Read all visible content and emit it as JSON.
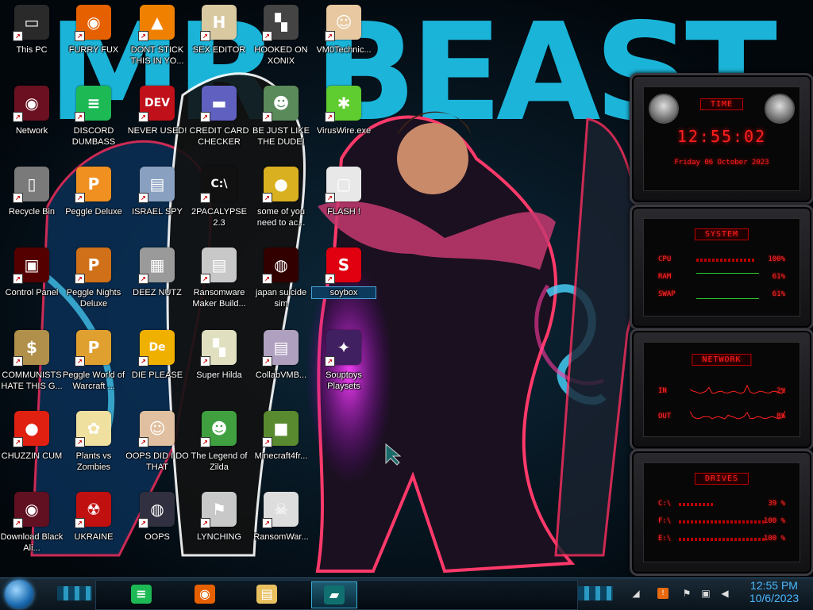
{
  "wallpaper": {
    "title_text": "MR BEAST"
  },
  "desktop_icons": [
    {
      "label": "This PC",
      "icon": "computer-icon",
      "color": "#2a2a2a",
      "glyph": "▭",
      "col": 0,
      "row": 0
    },
    {
      "label": "FURRY FUX",
      "icon": "firefox-icon",
      "color": "#e66000",
      "glyph": "◉",
      "col": 1,
      "row": 0
    },
    {
      "label": "DONT STICK THIS IN YO...",
      "icon": "vlc-cone-icon",
      "color": "#f08000",
      "glyph": "▲",
      "col": 2,
      "row": 0
    },
    {
      "label": "SEX EDITOR",
      "icon": "hxd-icon",
      "color": "#d9c9a0",
      "glyph": "H",
      "col": 3,
      "row": 0
    },
    {
      "label": "HOOKED ON XONIX",
      "icon": "xonix-game-icon",
      "color": "#444",
      "glyph": "▚",
      "col": 4,
      "row": 0
    },
    {
      "label": "VM0Technic...",
      "icon": "doctor-icon",
      "color": "#e8c8a0",
      "glyph": "☺",
      "col": 5,
      "row": 0
    },
    {
      "label": "Network",
      "icon": "alienware-network-icon",
      "color": "#6a1020",
      "glyph": "◉",
      "col": 0,
      "row": 1
    },
    {
      "label": "DISCORD DUMBASS",
      "icon": "spotify-green-icon",
      "color": "#1db954",
      "glyph": "≡",
      "col": 1,
      "row": 1
    },
    {
      "label": "NEVER USED!",
      "icon": "devcpp-icon",
      "color": "#c0101a",
      "glyph": "DEV",
      "col": 2,
      "row": 1
    },
    {
      "label": "CREDIT CARD CHECKER",
      "icon": "credit-card-icon",
      "color": "#6060c0",
      "glyph": "▬",
      "col": 3,
      "row": 1
    },
    {
      "label": "BE JUST LIKE THE DUDE!",
      "icon": "santa-icon",
      "color": "#5a8a5a",
      "glyph": "☻",
      "col": 4,
      "row": 1
    },
    {
      "label": "VirusWire.exe",
      "icon": "limewire-icon",
      "color": "#5fcc2f",
      "glyph": "✱",
      "col": 5,
      "row": 1
    },
    {
      "label": "Recycle Bin",
      "icon": "recycle-bin-icon",
      "color": "#7a7a7a",
      "glyph": "▯",
      "col": 0,
      "row": 2
    },
    {
      "label": "Peggle Deluxe",
      "icon": "peggle-icon",
      "color": "#f09020",
      "glyph": "P",
      "col": 1,
      "row": 2
    },
    {
      "label": "ISRAEL SPY",
      "icon": "network-spy-icon",
      "color": "#8aa0c0",
      "glyph": "▤",
      "col": 2,
      "row": 2
    },
    {
      "label": "2PACALYPSE 2.3",
      "icon": "terminal-icon",
      "color": "#111",
      "glyph": "C:\\",
      "col": 3,
      "row": 2
    },
    {
      "label": "some of you need to ac...",
      "icon": "beaver-icon",
      "color": "#d9b020",
      "glyph": "●",
      "col": 4,
      "row": 2
    },
    {
      "label": "FLASH !",
      "icon": "document-icon",
      "color": "#e8e8e8",
      "glyph": "▢",
      "col": 5,
      "row": 2
    },
    {
      "label": "Control Panel",
      "icon": "alienware-control-icon",
      "color": "#500",
      "glyph": "▣",
      "col": 0,
      "row": 3
    },
    {
      "label": "Peggle Nights Deluxe",
      "icon": "peggle-nights-icon",
      "color": "#d07018",
      "glyph": "P",
      "col": 1,
      "row": 3
    },
    {
      "label": "DEEZ NUTZ",
      "icon": "stacked-windows-icon",
      "color": "#9a9a9a",
      "glyph": "▦",
      "col": 2,
      "row": 3
    },
    {
      "label": "Ransomware Maker Build...",
      "icon": "app-window-icon",
      "color": "#c8c8c8",
      "glyph": "▤",
      "col": 3,
      "row": 3
    },
    {
      "label": "japan suicide sim",
      "icon": "alien-window-icon",
      "color": "#300",
      "glyph": "◍",
      "col": 4,
      "row": 3
    },
    {
      "label": "soybox",
      "icon": "soybox-icon",
      "color": "#e00010",
      "glyph": "S",
      "col": 5,
      "row": 3,
      "selected": true
    },
    {
      "label": "COMMUNISTS HATE THIS G...",
      "icon": "money-bag-icon",
      "color": "#b0904a",
      "glyph": "$",
      "col": 0,
      "row": 4
    },
    {
      "label": "Peggle World of Warcraft ...",
      "icon": "peggle-wow-icon",
      "color": "#e0a030",
      "glyph": "P",
      "col": 1,
      "row": 4
    },
    {
      "label": "DIE PLEASE",
      "icon": "dolphin-emu-icon",
      "color": "#f0b000",
      "glyph": "De",
      "col": 2,
      "row": 4
    },
    {
      "label": "Super Hilda",
      "icon": "pixel-dog-icon",
      "color": "#e0e0c0",
      "glyph": "▚",
      "col": 3,
      "row": 4
    },
    {
      "label": "CollabVMB...",
      "icon": "collabvm-icon",
      "color": "#b0a0c0",
      "glyph": "▤",
      "col": 4,
      "row": 4
    },
    {
      "label": "Souptoys Playsets",
      "icon": "galaxy-window-icon",
      "color": "#402060",
      "glyph": "✦",
      "col": 5,
      "row": 4
    },
    {
      "label": "CHUZZIN CUM",
      "icon": "chuzzle-icon",
      "color": "#e02010",
      "glyph": "●",
      "col": 0,
      "row": 5
    },
    {
      "label": "Plants vs Zombies",
      "icon": "pvz-flower-icon",
      "color": "#f0e0a0",
      "glyph": "✿",
      "col": 1,
      "row": 5
    },
    {
      "label": "OOPS DID I DO THAT",
      "icon": "portrait-icon",
      "color": "#e0c0a0",
      "glyph": "☺",
      "col": 2,
      "row": 5
    },
    {
      "label": "The Legend of Zilda",
      "icon": "zelda-sprite-icon",
      "color": "#40a040",
      "glyph": "☻",
      "col": 3,
      "row": 5
    },
    {
      "label": "Minecraft4fr...",
      "icon": "minecraft-block-icon",
      "color": "#5a8a30",
      "glyph": "■",
      "col": 4,
      "row": 5
    },
    {
      "label": "Download Black Ali...",
      "icon": "alienware-download-icon",
      "color": "#601020",
      "glyph": "◉",
      "col": 0,
      "row": 6
    },
    {
      "label": "UKRAINE",
      "icon": "radiation-icon",
      "color": "#c01010",
      "glyph": "☢",
      "col": 1,
      "row": 6
    },
    {
      "label": "OOPS",
      "icon": "alien-book-icon",
      "color": "#303040",
      "glyph": "◍",
      "col": 2,
      "row": 6
    },
    {
      "label": "LYNCHING",
      "icon": "network-flag-icon",
      "color": "#c8c8c8",
      "glyph": "⚑",
      "col": 3,
      "row": 6
    },
    {
      "label": "RansomWar...",
      "icon": "skull-icon",
      "color": "#ddd",
      "glyph": "☠",
      "col": 4,
      "row": 6
    }
  ],
  "gadgets": {
    "time": {
      "title": "TIME",
      "clock": "12:55:02",
      "date": "Friday 06 October 2023"
    },
    "system": {
      "title": "SYSTEM",
      "rows": [
        {
          "label": "CPU",
          "value": "100%",
          "fill": 1.0
        },
        {
          "label": "RAM",
          "value": "61%",
          "fill": 0.61
        },
        {
          "label": "SWAP",
          "value": "61%",
          "fill": 0.61
        }
      ]
    },
    "network": {
      "title": "NETWORK",
      "rows": [
        {
          "label": "IN",
          "value": "2%"
        },
        {
          "label": "OUT",
          "value": "8%"
        }
      ]
    },
    "drives": {
      "title": "DRIVES",
      "rows": [
        {
          "label": "C:\\",
          "value": "39 %",
          "fill": 0.39
        },
        {
          "label": "F:\\",
          "value": "100 %",
          "fill": 1.0
        },
        {
          "label": "E:\\",
          "value": "100 %",
          "fill": 1.0
        }
      ]
    }
  },
  "taskbar": {
    "start_icon": "start-orb-icon",
    "pinned": [
      {
        "name": "spotify-taskbar-icon",
        "color": "#1db954",
        "glyph": "≡"
      },
      {
        "name": "firefox-taskbar-icon",
        "color": "#e66000",
        "glyph": "◉"
      },
      {
        "name": "file-explorer-taskbar-icon",
        "color": "#e8c060",
        "glyph": "▤"
      },
      {
        "name": "soybox-taskbar-icon",
        "color": "#107070",
        "glyph": "▰",
        "active": true
      }
    ],
    "clock": {
      "time": "12:55 PM",
      "date": "10/6/2023"
    }
  }
}
